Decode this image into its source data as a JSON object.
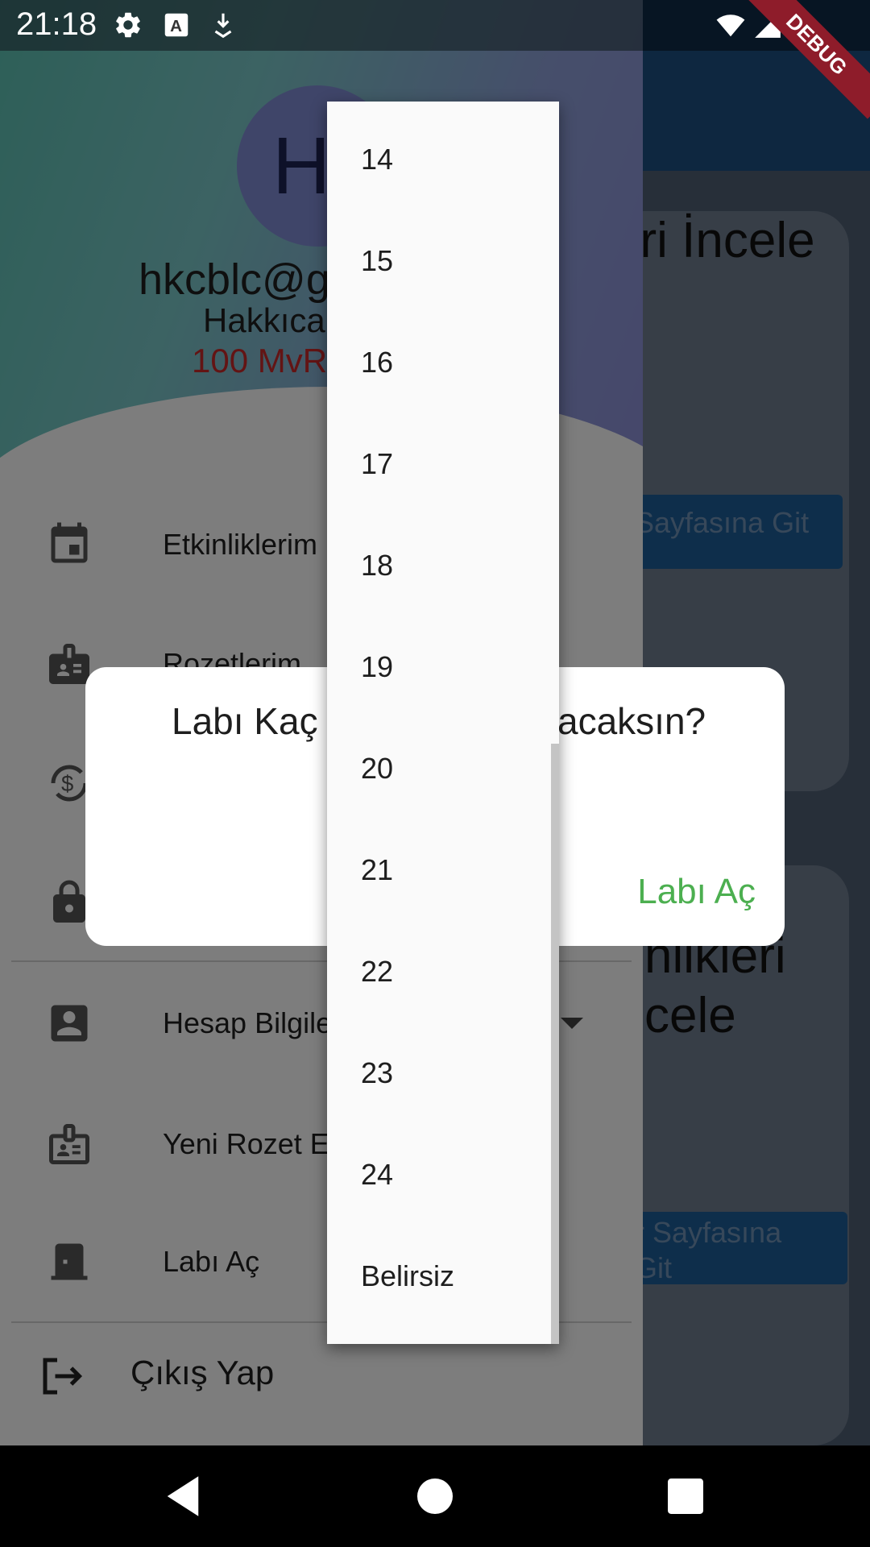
{
  "status_bar": {
    "time": "21:18",
    "debug_label": "DEBUG"
  },
  "background_page": {
    "card1_title": "eri İncele",
    "card1_button": "Sayfasına Git",
    "card2_title": "nlikleri\ncele",
    "card2_button": "r Sayfasına\nGit"
  },
  "drawer": {
    "avatar_initials": "HK",
    "email": "hkcblc@gmail.com",
    "username": "Hakkıcan Bülüç",
    "points": "100 MvRe",
    "items": [
      {
        "label": "Etkinliklerim",
        "icon": "calendar-icon"
      },
      {
        "label": "Rozetlerim",
        "icon": "badge-icon"
      },
      {
        "label": "",
        "icon": "currency-exchange-icon"
      },
      {
        "label": "",
        "icon": "lock-icon"
      },
      {
        "label": "Hesap Bilgileri",
        "icon": "account-box-icon"
      },
      {
        "label": "Yeni Rozet Ekle",
        "icon": "badge-outline-icon"
      },
      {
        "label": "Labı Aç",
        "icon": "door-icon"
      }
    ],
    "logout_label": "Çıkış Yap"
  },
  "dialog": {
    "title_start": "Labı Kaç",
    "title_end": "acaksın?",
    "action_label": "Labı Aç",
    "accent_color": "#4caf50"
  },
  "dropdown": {
    "options": [
      "14",
      "15",
      "16",
      "17",
      "18",
      "19",
      "20",
      "21",
      "22",
      "23",
      "24",
      "Belirsiz"
    ]
  }
}
